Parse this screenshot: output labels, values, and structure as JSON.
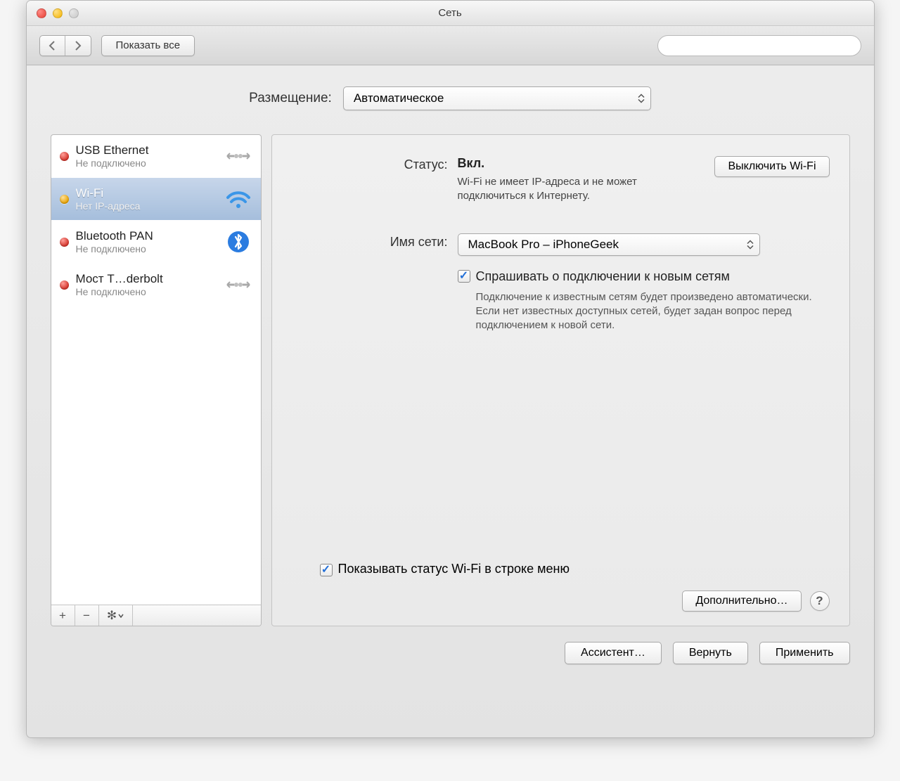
{
  "window": {
    "title": "Сеть"
  },
  "toolbar": {
    "show_all": "Показать все",
    "search_placeholder": ""
  },
  "location": {
    "label": "Размещение:",
    "selected": "Автоматическое"
  },
  "sidebar": {
    "items": [
      {
        "name": "USB Ethernet",
        "status": "Не подключено",
        "dot": "red",
        "icon": "ethernet"
      },
      {
        "name": "Wi-Fi",
        "status": "Нет IP-адреса",
        "dot": "yellow",
        "icon": "wifi",
        "selected": true
      },
      {
        "name": "Bluetooth PAN",
        "status": "Не подключено",
        "dot": "red",
        "icon": "bluetooth"
      },
      {
        "name": "Мост T…derbolt",
        "status": "Не подключено",
        "dot": "red",
        "icon": "ethernet"
      }
    ],
    "footer": {
      "add": "+",
      "remove": "−",
      "gear": "⚙"
    }
  },
  "detail": {
    "status_label": "Статус:",
    "status_value": "Вкл.",
    "status_desc": "Wi-Fi не имеет IP-адреса и не может подключиться к Интернету.",
    "turn_off_btn": "Выключить Wi-Fi",
    "network_label": "Имя сети:",
    "network_selected": "MacBook Pro – iPhoneGeek",
    "ask_checkbox_label": "Спрашивать о подключении к новым сетям",
    "ask_desc": "Подключение к известным сетям будет произведено автоматически. Если нет известных доступных сетей, будет задан вопрос перед подключением к новой сети.",
    "show_status_label": "Показывать статус Wi-Fi в строке меню",
    "advanced_btn": "Дополнительно…",
    "help": "?"
  },
  "bottom": {
    "assist": "Ассистент…",
    "revert": "Вернуть",
    "apply": "Применить"
  }
}
